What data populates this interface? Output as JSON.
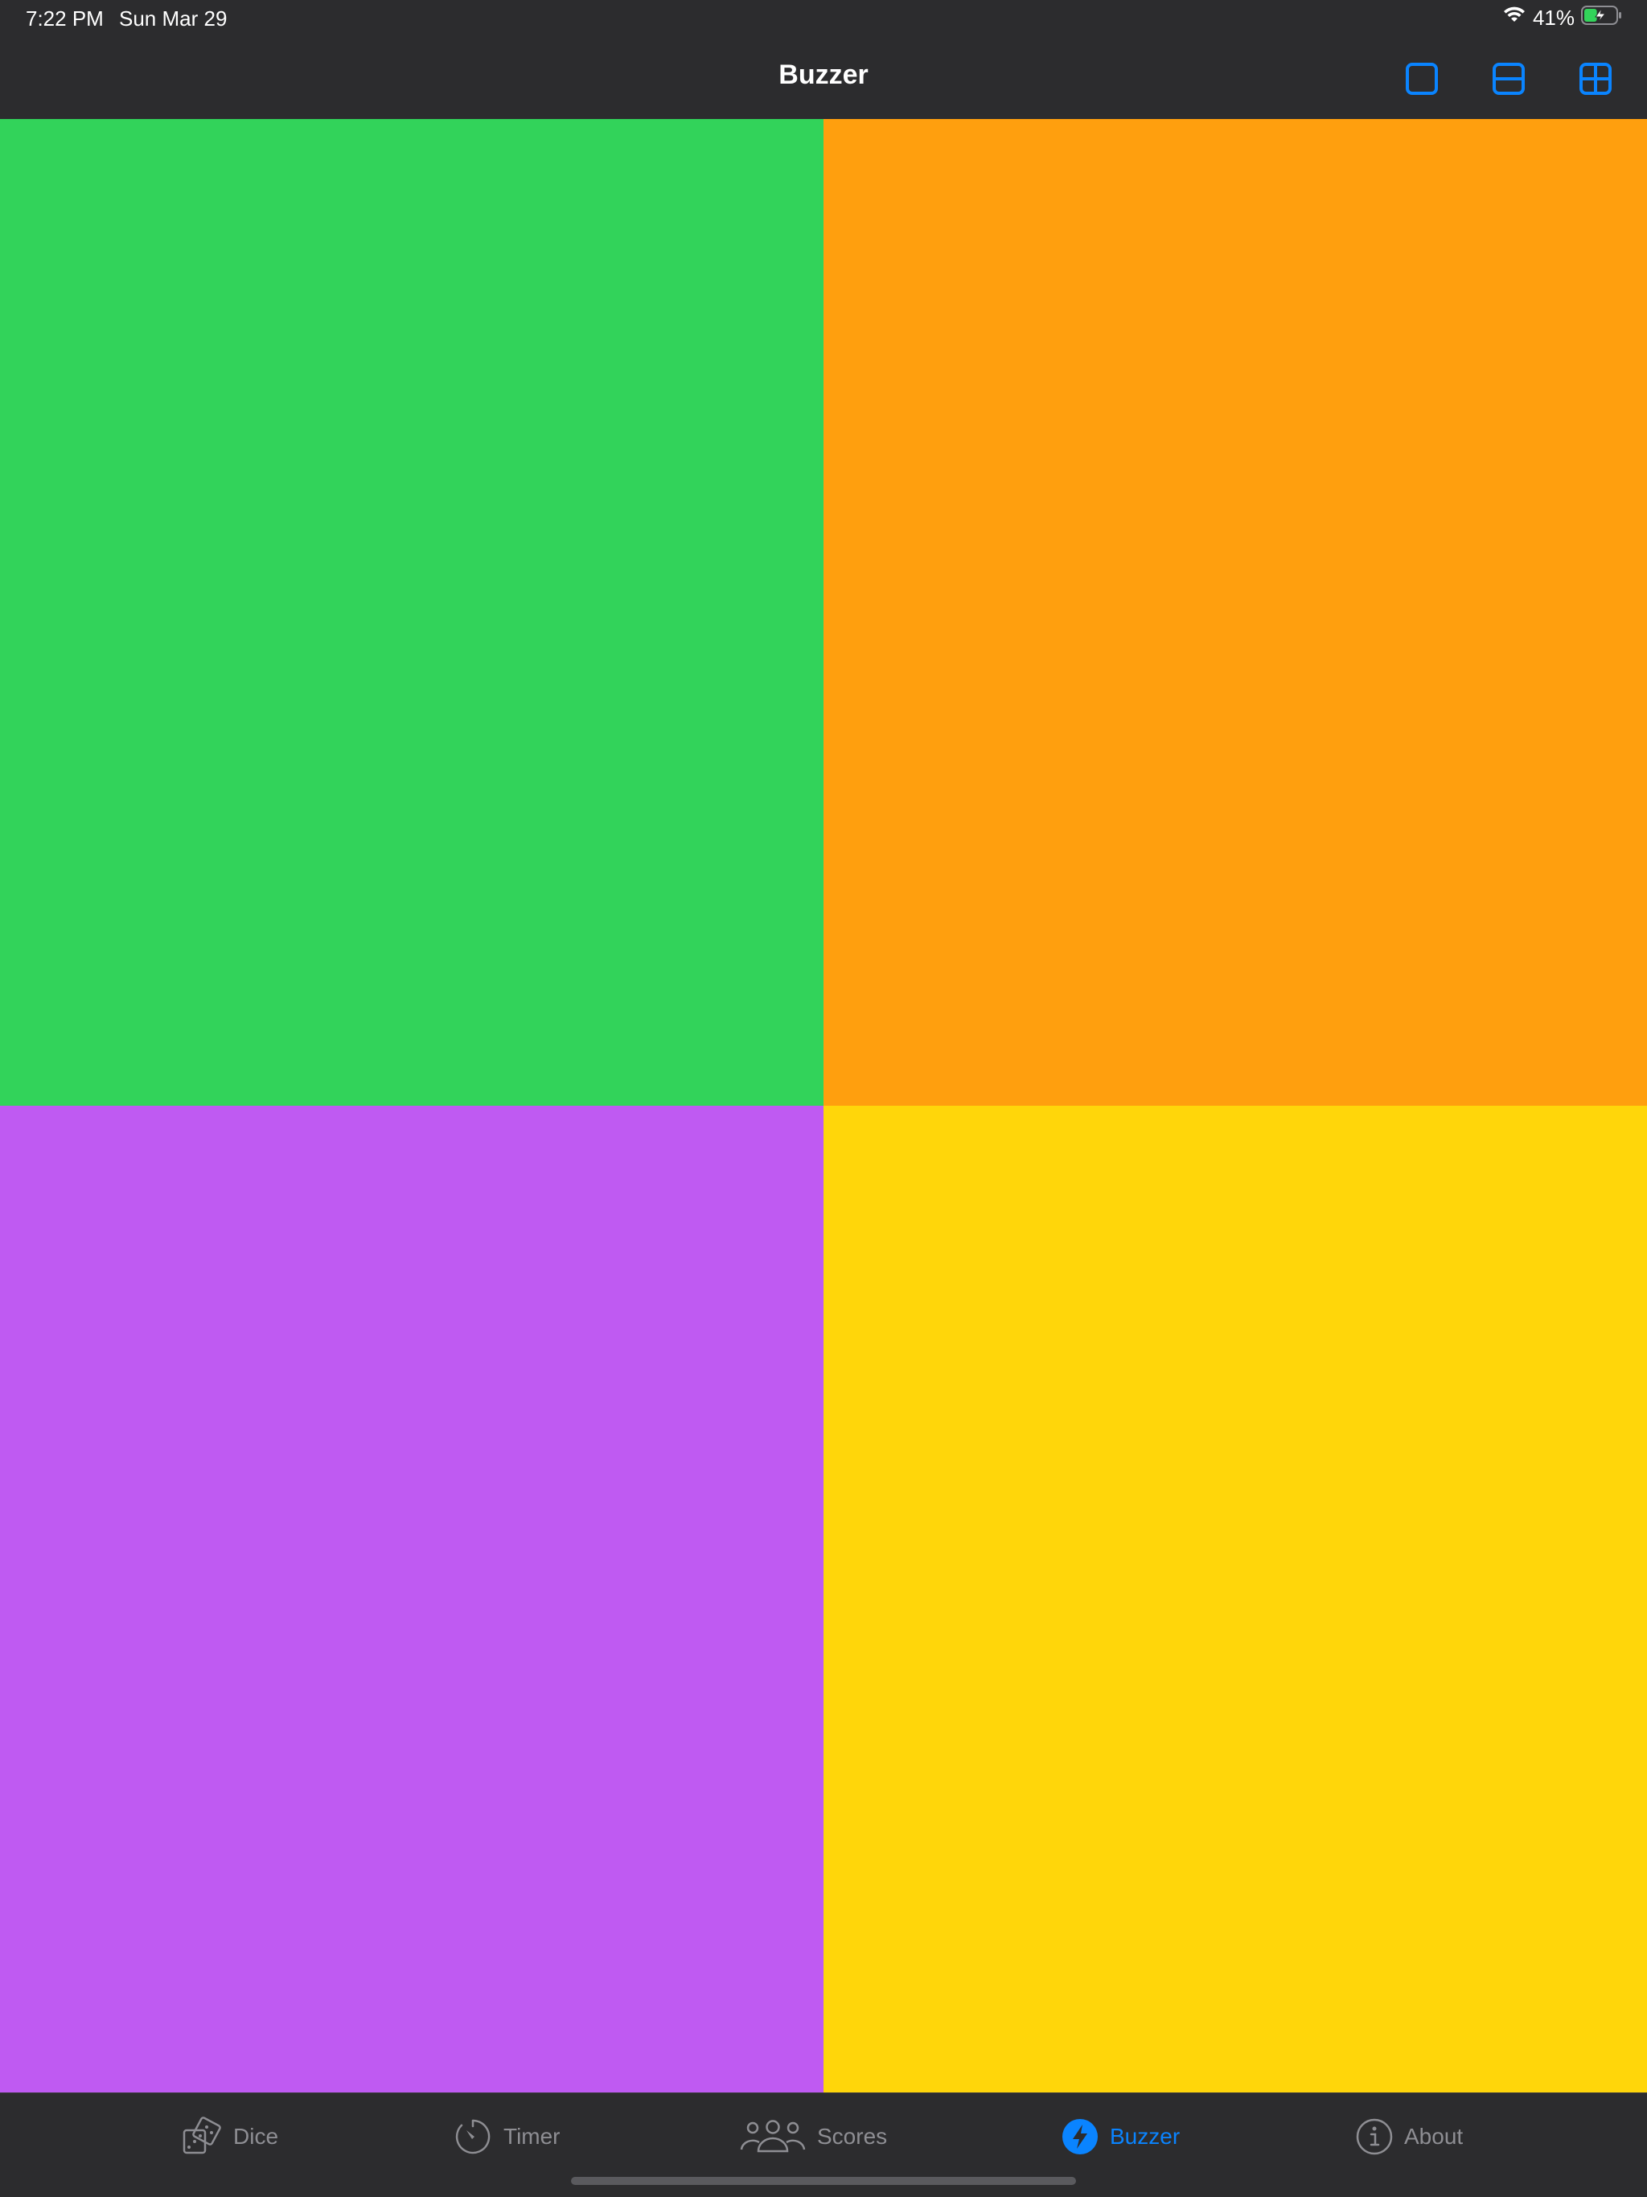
{
  "status_bar": {
    "time": "7:22 PM",
    "date": "Sun Mar 29",
    "battery_percent": "41%",
    "battery_level": 0.41,
    "charging": true
  },
  "nav": {
    "title": "Buzzer",
    "layout_buttons": [
      {
        "name": "single-layout",
        "icon": "square-icon"
      },
      {
        "name": "split-layout",
        "icon": "square-split-2-icon"
      },
      {
        "name": "quad-layout",
        "icon": "square-grid-2x2-icon"
      }
    ]
  },
  "pads": [
    {
      "name": "green-pad",
      "color": "#32d35a"
    },
    {
      "name": "orange-pad",
      "color": "#ff9f0e"
    },
    {
      "name": "purple-pad",
      "color": "#bf5af2"
    },
    {
      "name": "yellow-pad",
      "color": "#ffd60a"
    }
  ],
  "tabs": [
    {
      "label": "Dice",
      "icon": "dice-icon",
      "active": false
    },
    {
      "label": "Timer",
      "icon": "timer-icon",
      "active": false
    },
    {
      "label": "Scores",
      "icon": "people-icon",
      "active": false
    },
    {
      "label": "Buzzer",
      "icon": "bolt-icon",
      "active": true
    },
    {
      "label": "About",
      "icon": "info-icon",
      "active": false
    }
  ],
  "colors": {
    "accent": "#0a84ff",
    "bar_background": "#2c2c2e",
    "inactive_tab": "#8e8e93"
  }
}
